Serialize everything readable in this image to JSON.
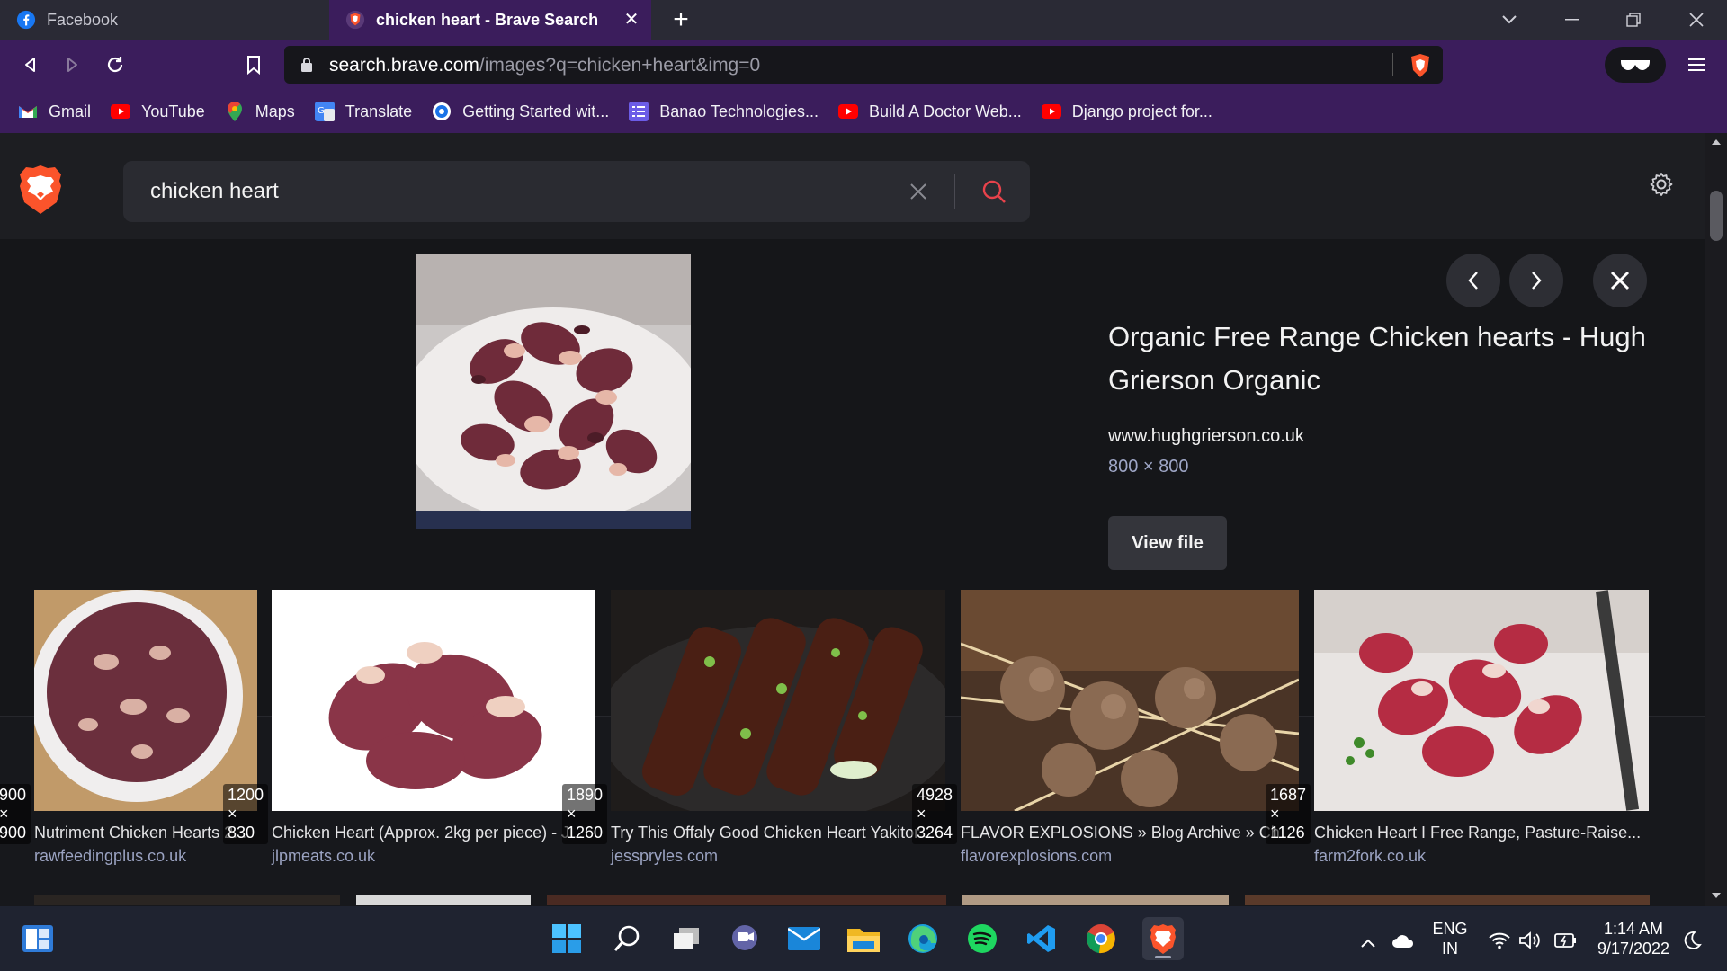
{
  "tabs": [
    {
      "title": "Facebook",
      "icon": "facebook-icon",
      "active": false
    },
    {
      "title": "chicken heart - Brave Search",
      "icon": "brave-shield-icon",
      "active": true
    }
  ],
  "address_bar": {
    "host": "search.brave.com",
    "path": "/images?q=chicken+heart&img=0"
  },
  "bookmarks": [
    {
      "label": "Gmail",
      "icon": "gmail-icon"
    },
    {
      "label": "YouTube",
      "icon": "youtube-icon"
    },
    {
      "label": "Maps",
      "icon": "maps-icon"
    },
    {
      "label": "Translate",
      "icon": "translate-icon"
    },
    {
      "label": "Getting Started wit...",
      "icon": "globe-icon"
    },
    {
      "label": "Banao Technologies...",
      "icon": "list-icon"
    },
    {
      "label": "Build A Doctor Web...",
      "icon": "youtube-icon"
    },
    {
      "label": "Django project for...",
      "icon": "youtube-icon"
    }
  ],
  "search": {
    "query": "chicken heart"
  },
  "preview": {
    "title": "Organic Free Range Chicken hearts - Hugh Grierson Organic",
    "domain": "www.hughgrierson.co.uk",
    "dimensions": "800 × 800",
    "view_file_label": "View file"
  },
  "results": [
    {
      "dims": "900 × 900",
      "title": "Nutriment Chicken Hearts 2...",
      "source": "rawfeedingplus.co.uk"
    },
    {
      "dims": "1200 × 830",
      "title": "Chicken Heart (Approx. 2kg per piece) - J...",
      "source": "jlpmeats.co.uk"
    },
    {
      "dims": "1890 × 1260",
      "title": "Try This Offaly Good Chicken Heart Yakitor...",
      "source": "jesspryles.com"
    },
    {
      "dims": "4928 × 3264",
      "title": "FLAVOR EXPLOSIONS » Blog Archive » Chic...",
      "source": "flavorexplosions.com"
    },
    {
      "dims": "1687 × 1126",
      "title": "Chicken Heart I Free Range, Pasture-Raise...",
      "source": "farm2fork.co.uk"
    }
  ],
  "taskbar": {
    "language": "ENG",
    "region": "IN",
    "time": "1:14 AM",
    "date": "9/17/2022"
  },
  "colors": {
    "brand_purple": "#3b1d5c",
    "brave_orange": "#fb542b",
    "search_red": "#e8424b"
  }
}
